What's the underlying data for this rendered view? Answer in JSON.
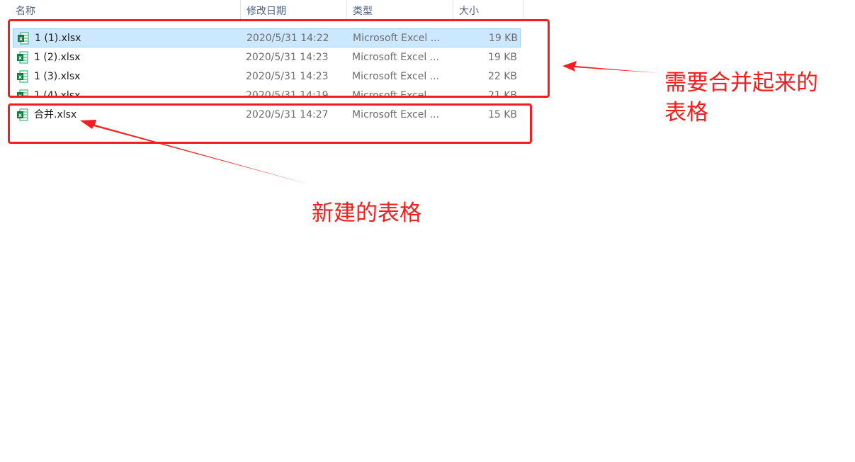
{
  "header": {
    "col_name": "名称",
    "col_date": "修改日期",
    "col_type": "类型",
    "col_size": "大小",
    "sort_indicator": "^"
  },
  "files": [
    {
      "name": "1 (1).xlsx",
      "date": "2020/5/31 14:22",
      "type": "Microsoft Excel ...",
      "size": "19 KB",
      "selected": true
    },
    {
      "name": "1 (2).xlsx",
      "date": "2020/5/31 14:23",
      "type": "Microsoft Excel ...",
      "size": "19 KB",
      "selected": false
    },
    {
      "name": "1 (3).xlsx",
      "date": "2020/5/31 14:23",
      "type": "Microsoft Excel ...",
      "size": "22 KB",
      "selected": false
    },
    {
      "name": "1 (4).xlsx",
      "date": "2020/5/31 14:19",
      "type": "Microsoft Excel ...",
      "size": "21 KB",
      "selected": false
    },
    {
      "name": "合并.xlsx",
      "date": "2020/5/31 14:27",
      "type": "Microsoft Excel ...",
      "size": "15 KB",
      "selected": false
    }
  ],
  "annotations": {
    "merge_note_line1": "需要合并起来的",
    "merge_note_line2": "表格",
    "new_note": "新建的表格",
    "color": "#f51d1d"
  },
  "icons": {
    "file_icon": "excel-file-icon"
  }
}
